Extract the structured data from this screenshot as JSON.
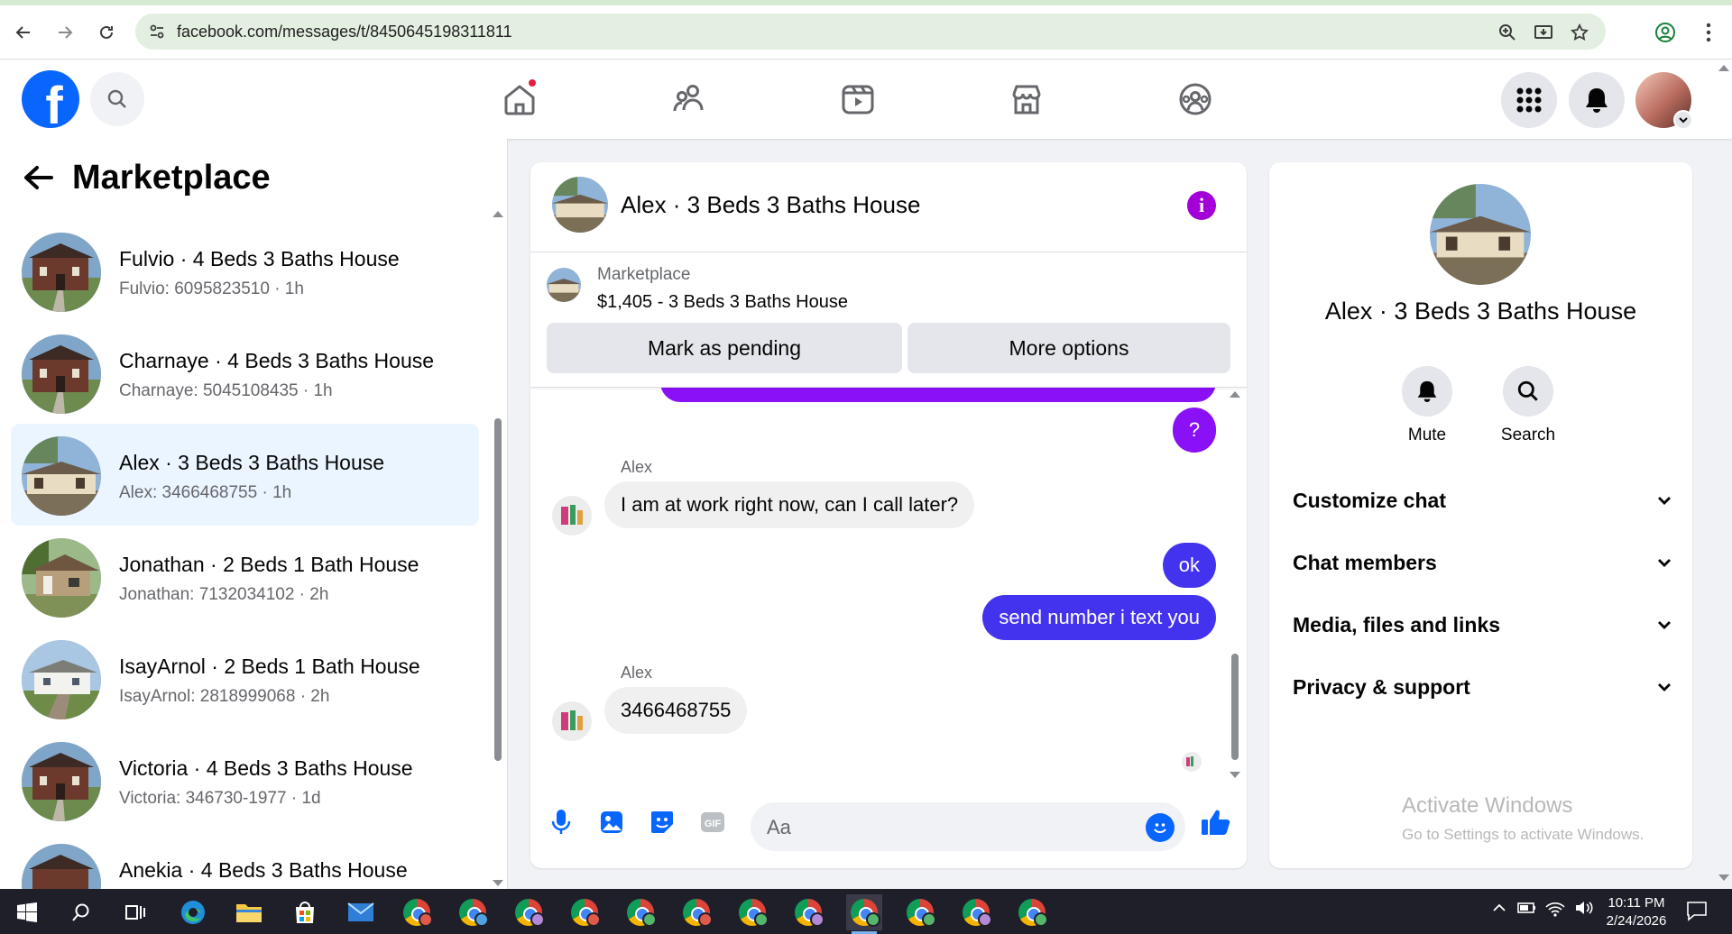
{
  "browser": {
    "url": "facebook.com/messages/t/8450645198311811"
  },
  "sidebar": {
    "title": "Marketplace",
    "conversations": [
      {
        "title": "Fulvio · 4 Beds 3 Baths House",
        "subtitle": "Fulvio: 6095823510 · 1h",
        "active": false
      },
      {
        "title": "Charnaye · 4 Beds 3 Baths House",
        "subtitle": "Charnaye: 5045108435 · 1h",
        "active": false
      },
      {
        "title": "Alex · 3 Beds 3 Baths House",
        "subtitle": "Alex: 3466468755 · 1h",
        "active": true
      },
      {
        "title": "Jonathan · 2 Beds 1 Bath House",
        "subtitle": "Jonathan: 7132034102 · 2h",
        "active": false
      },
      {
        "title": "IsayArnol · 2 Beds 1 Bath House",
        "subtitle": "IsayArnol: 2818999068 · 2h",
        "active": false
      },
      {
        "title": "Victoria · 4 Beds 3 Baths House",
        "subtitle": "Victoria: 346730-1977 · 1d",
        "active": false
      },
      {
        "title": "Anekia · 4 Beds 3 Baths House",
        "subtitle": "",
        "active": false
      }
    ]
  },
  "chat": {
    "title": "Alex · 3 Beds 3 Baths House",
    "listing": {
      "label": "Marketplace",
      "price_line": "$1,405 - 3 Beds 3 Baths House",
      "mark_pending": "Mark as pending",
      "more_options": "More options"
    },
    "messages": {
      "out_question": "?",
      "in_sender_1": "Alex",
      "in_text_1": "I am at work right now, can I call later?",
      "out_ok": "ok",
      "out_send": "send number i text you",
      "in_sender_2": "Alex",
      "in_text_2": "3466468755"
    },
    "composer": {
      "placeholder": "Aa"
    }
  },
  "details": {
    "name": "Alex · 3 Beds 3 Baths House",
    "mute_label": "Mute",
    "search_label": "Search",
    "sections": [
      "Customize chat",
      "Chat members",
      "Media, files and links",
      "Privacy & support"
    ]
  },
  "watermark": {
    "line1": "Activate Windows",
    "line2": "Go to Settings to activate Windows."
  },
  "taskbar": {
    "time": "10:11 PM",
    "date": "2/24/2026"
  },
  "colors": {
    "fb_blue": "#0866ff",
    "outgoing_bubble": "#4433ee",
    "outgoing_bubble_top": "#8a10f5",
    "info_purple": "#a300d9",
    "active_row": "#ebf5ff"
  }
}
